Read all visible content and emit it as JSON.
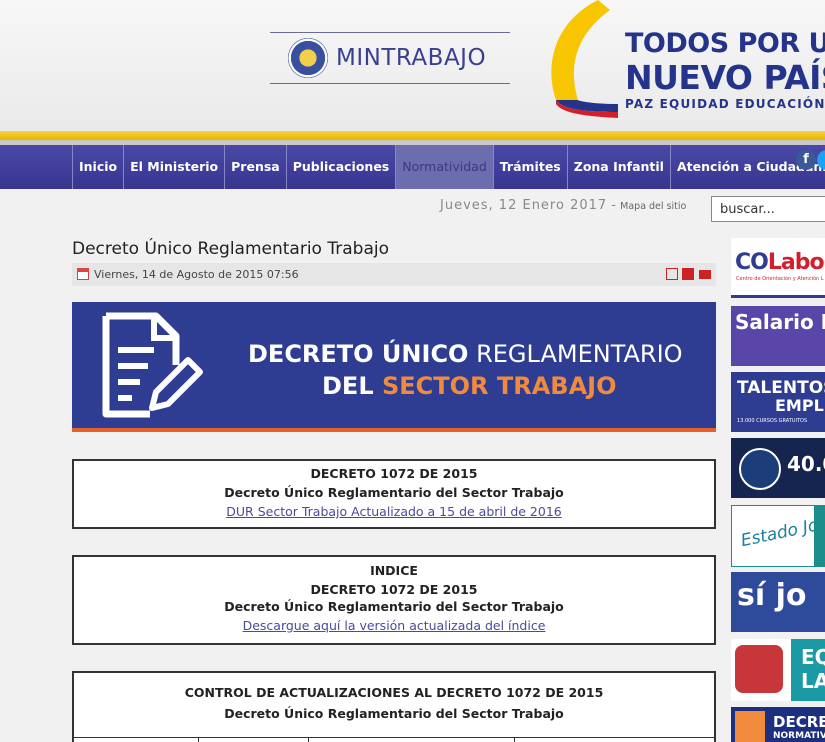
{
  "header": {
    "brand": "MINTRABAJO",
    "slogan_line1": "TODOS POR UN",
    "slogan_line2": "NUEVO PAÍS",
    "slogan_line3": "PAZ  EQUIDAD  EDUCACIÓN"
  },
  "nav": {
    "items": [
      {
        "label": "Inicio"
      },
      {
        "label": "El Ministerio"
      },
      {
        "label": "Prensa"
      },
      {
        "label": "Publicaciones"
      },
      {
        "label": "Normatividad",
        "active": true
      },
      {
        "label": "Trámites"
      },
      {
        "label": "Zona Infantil"
      },
      {
        "label": "Atención a Ciudadanía"
      }
    ],
    "facebook_icon": "f"
  },
  "toolbar": {
    "date": "Jueves, 12 Enero 2017",
    "separator": "-",
    "sitemap": "Mapa del sitio",
    "search_value": "buscar..."
  },
  "article": {
    "title": "Decreto Único Reglamentario Trabajo",
    "published": "Viernes, 14 de Agosto de 2015 07:56",
    "banner": {
      "line1_bold": "DECRETO ÚNICO",
      "line1_rest": "REGLAMENTARIO",
      "line2_white": "DEL",
      "line2_orange": "SECTOR TRABAJO"
    },
    "box1": {
      "title": "DECRETO 1072 DE 2015",
      "subtitle": "Decreto Único Reglamentario del Sector Trabajo",
      "link": "DUR Sector Trabajo Actualizado a 15 de abril de 2016"
    },
    "box2": {
      "heading": "INDICE",
      "title": "DECRETO 1072 DE 2015",
      "subtitle": "Decreto Único Reglamentario del Sector Trabajo",
      "link": "Descargue aquí la versión actualizada del índice"
    },
    "box3": {
      "title": "CONTROL DE ACTUALIZACIONES AL DECRETO 1072 DE 2015",
      "subtitle": "Decreto Único Reglamentario del Sector Trabajo"
    }
  },
  "sidebar": {
    "colabora": {
      "co": "CO",
      "rest": "Labor",
      "sub": "Centro de Orientación y Atención L"
    },
    "salario": "Salario M",
    "talentos": {
      "l1": "TALENTOS",
      "l2": "EMPLEO",
      "l3": "13.000 CURSOS GRATUITOS"
    },
    "primeros": "40.0",
    "estado_joven": "Estado Joven",
    "si_jo": "sí jo",
    "eq": {
      "l1": "EQ",
      "l2": "LA"
    },
    "decreto": {
      "l1": "DECRET",
      "l2": "NORMATIV"
    }
  }
}
